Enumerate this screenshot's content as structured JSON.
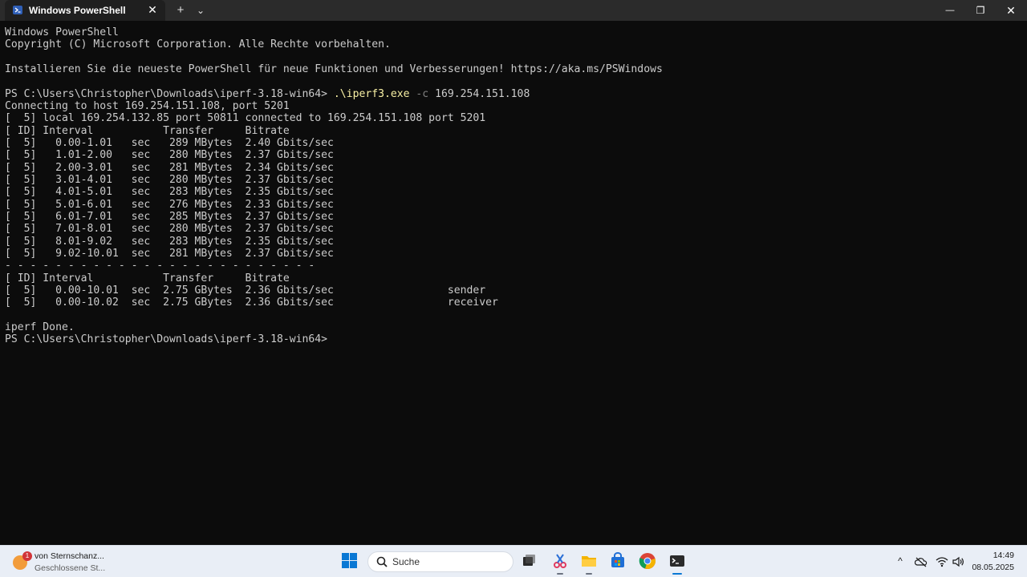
{
  "window": {
    "tab_title": "Windows PowerShell",
    "tab_close": "✕",
    "new_tab": "+",
    "dropdown": "⌄",
    "minimize": "—",
    "restore": "❐",
    "close": "✕"
  },
  "terminal": {
    "lines": [
      "Windows PowerShell",
      "Copyright (C) Microsoft Corporation. Alle Rechte vorbehalten.",
      "",
      "Installieren Sie die neueste PowerShell für neue Funktionen und Verbesserungen! https://aka.ms/PSWindows",
      "",
      "",
      "Connecting to host 169.254.151.108, port 5201",
      "[  5] local 169.254.132.85 port 50811 connected to 169.254.151.108 port 5201",
      "[ ID] Interval           Transfer     Bitrate",
      "[  5]   0.00-1.01   sec   289 MBytes  2.40 Gbits/sec",
      "[  5]   1.01-2.00   sec   280 MBytes  2.37 Gbits/sec",
      "[  5]   2.00-3.01   sec   281 MBytes  2.34 Gbits/sec",
      "[  5]   3.01-4.01   sec   280 MBytes  2.37 Gbits/sec",
      "[  5]   4.01-5.01   sec   283 MBytes  2.35 Gbits/sec",
      "[  5]   5.01-6.01   sec   276 MBytes  2.33 Gbits/sec",
      "[  5]   6.01-7.01   sec   285 MBytes  2.37 Gbits/sec",
      "[  5]   7.01-8.01   sec   280 MBytes  2.37 Gbits/sec",
      "[  5]   8.01-9.02   sec   283 MBytes  2.35 Gbits/sec",
      "[  5]   9.02-10.01  sec   281 MBytes  2.37 Gbits/sec",
      "- - - - - - - - - - - - - - - - - - - - - - - - -",
      "[ ID] Interval           Transfer     Bitrate",
      "[  5]   0.00-10.01  sec  2.75 GBytes  2.36 Gbits/sec                  sender",
      "[  5]   0.00-10.02  sec  2.75 GBytes  2.36 Gbits/sec                  receiver",
      "",
      "iperf Done.",
      "PS C:\\Users\\Christopher\\Downloads\\iperf-3.18-win64>"
    ],
    "command_line": {
      "prompt": "PS C:\\Users\\Christopher\\Downloads\\iperf-3.18-win64> ",
      "command": ".\\iperf3.exe",
      "flag": " -c ",
      "argument": "169.254.151.108"
    }
  },
  "taskbar": {
    "widget": {
      "badge": "1",
      "title": "von Sternschanz...",
      "subtitle": "Geschlossene St..."
    },
    "search_placeholder": "Suche",
    "apps": [
      "task-view",
      "snipping-tool",
      "file-explorer",
      "microsoft-store",
      "chrome",
      "terminal"
    ],
    "tray": {
      "chevron": "^",
      "time": "14:49",
      "date": "08.05.2025"
    }
  },
  "colors": {
    "terminal_bg": "#0c0c0c",
    "terminal_text": "#cccccc",
    "command_text": "#f9f1a5",
    "flag_text": "#808080",
    "titlebar_bg": "#2b2b2b",
    "taskbar_bg": "#e9eef6",
    "accent": "#0a78d4"
  }
}
